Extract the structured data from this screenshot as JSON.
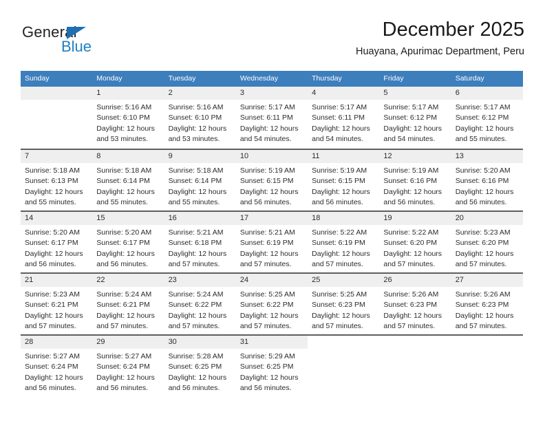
{
  "brand": {
    "name_top": "General",
    "name_bottom": "Blue",
    "triangle_color": "#1f6fb2",
    "blue_color": "#1f7fc4"
  },
  "header": {
    "title": "December 2025",
    "subtitle": "Huayana, Apurimac Department, Peru"
  },
  "theme": {
    "header_row_bg": "#3d7ebd",
    "header_row_text": "#ffffff",
    "daynum_bg": "#efefef",
    "week_divider": "#5b5f63",
    "body_text": "#2b2b2b"
  },
  "weekdays": [
    "Sunday",
    "Monday",
    "Tuesday",
    "Wednesday",
    "Thursday",
    "Friday",
    "Saturday"
  ],
  "labels": {
    "sunrise_prefix": "Sunrise:",
    "sunset_prefix": "Sunset:",
    "daylight_prefix": "Daylight:"
  },
  "weeks": [
    [
      {
        "day": "",
        "sunrise": "",
        "sunset": "",
        "daylight": "",
        "empty": true
      },
      {
        "day": "1",
        "sunrise": "Sunrise: 5:16 AM",
        "sunset": "Sunset: 6:10 PM",
        "daylight": "Daylight: 12 hours and 53 minutes."
      },
      {
        "day": "2",
        "sunrise": "Sunrise: 5:16 AM",
        "sunset": "Sunset: 6:10 PM",
        "daylight": "Daylight: 12 hours and 53 minutes."
      },
      {
        "day": "3",
        "sunrise": "Sunrise: 5:17 AM",
        "sunset": "Sunset: 6:11 PM",
        "daylight": "Daylight: 12 hours and 54 minutes."
      },
      {
        "day": "4",
        "sunrise": "Sunrise: 5:17 AM",
        "sunset": "Sunset: 6:11 PM",
        "daylight": "Daylight: 12 hours and 54 minutes."
      },
      {
        "day": "5",
        "sunrise": "Sunrise: 5:17 AM",
        "sunset": "Sunset: 6:12 PM",
        "daylight": "Daylight: 12 hours and 54 minutes."
      },
      {
        "day": "6",
        "sunrise": "Sunrise: 5:17 AM",
        "sunset": "Sunset: 6:12 PM",
        "daylight": "Daylight: 12 hours and 55 minutes."
      }
    ],
    [
      {
        "day": "7",
        "sunrise": "Sunrise: 5:18 AM",
        "sunset": "Sunset: 6:13 PM",
        "daylight": "Daylight: 12 hours and 55 minutes."
      },
      {
        "day": "8",
        "sunrise": "Sunrise: 5:18 AM",
        "sunset": "Sunset: 6:14 PM",
        "daylight": "Daylight: 12 hours and 55 minutes."
      },
      {
        "day": "9",
        "sunrise": "Sunrise: 5:18 AM",
        "sunset": "Sunset: 6:14 PM",
        "daylight": "Daylight: 12 hours and 55 minutes."
      },
      {
        "day": "10",
        "sunrise": "Sunrise: 5:19 AM",
        "sunset": "Sunset: 6:15 PM",
        "daylight": "Daylight: 12 hours and 56 minutes."
      },
      {
        "day": "11",
        "sunrise": "Sunrise: 5:19 AM",
        "sunset": "Sunset: 6:15 PM",
        "daylight": "Daylight: 12 hours and 56 minutes."
      },
      {
        "day": "12",
        "sunrise": "Sunrise: 5:19 AM",
        "sunset": "Sunset: 6:16 PM",
        "daylight": "Daylight: 12 hours and 56 minutes."
      },
      {
        "day": "13",
        "sunrise": "Sunrise: 5:20 AM",
        "sunset": "Sunset: 6:16 PM",
        "daylight": "Daylight: 12 hours and 56 minutes."
      }
    ],
    [
      {
        "day": "14",
        "sunrise": "Sunrise: 5:20 AM",
        "sunset": "Sunset: 6:17 PM",
        "daylight": "Daylight: 12 hours and 56 minutes."
      },
      {
        "day": "15",
        "sunrise": "Sunrise: 5:20 AM",
        "sunset": "Sunset: 6:17 PM",
        "daylight": "Daylight: 12 hours and 56 minutes."
      },
      {
        "day": "16",
        "sunrise": "Sunrise: 5:21 AM",
        "sunset": "Sunset: 6:18 PM",
        "daylight": "Daylight: 12 hours and 57 minutes."
      },
      {
        "day": "17",
        "sunrise": "Sunrise: 5:21 AM",
        "sunset": "Sunset: 6:19 PM",
        "daylight": "Daylight: 12 hours and 57 minutes."
      },
      {
        "day": "18",
        "sunrise": "Sunrise: 5:22 AM",
        "sunset": "Sunset: 6:19 PM",
        "daylight": "Daylight: 12 hours and 57 minutes."
      },
      {
        "day": "19",
        "sunrise": "Sunrise: 5:22 AM",
        "sunset": "Sunset: 6:20 PM",
        "daylight": "Daylight: 12 hours and 57 minutes."
      },
      {
        "day": "20",
        "sunrise": "Sunrise: 5:23 AM",
        "sunset": "Sunset: 6:20 PM",
        "daylight": "Daylight: 12 hours and 57 minutes."
      }
    ],
    [
      {
        "day": "21",
        "sunrise": "Sunrise: 5:23 AM",
        "sunset": "Sunset: 6:21 PM",
        "daylight": "Daylight: 12 hours and 57 minutes."
      },
      {
        "day": "22",
        "sunrise": "Sunrise: 5:24 AM",
        "sunset": "Sunset: 6:21 PM",
        "daylight": "Daylight: 12 hours and 57 minutes."
      },
      {
        "day": "23",
        "sunrise": "Sunrise: 5:24 AM",
        "sunset": "Sunset: 6:22 PM",
        "daylight": "Daylight: 12 hours and 57 minutes."
      },
      {
        "day": "24",
        "sunrise": "Sunrise: 5:25 AM",
        "sunset": "Sunset: 6:22 PM",
        "daylight": "Daylight: 12 hours and 57 minutes."
      },
      {
        "day": "25",
        "sunrise": "Sunrise: 5:25 AM",
        "sunset": "Sunset: 6:23 PM",
        "daylight": "Daylight: 12 hours and 57 minutes."
      },
      {
        "day": "26",
        "sunrise": "Sunrise: 5:26 AM",
        "sunset": "Sunset: 6:23 PM",
        "daylight": "Daylight: 12 hours and 57 minutes."
      },
      {
        "day": "27",
        "sunrise": "Sunrise: 5:26 AM",
        "sunset": "Sunset: 6:23 PM",
        "daylight": "Daylight: 12 hours and 57 minutes."
      }
    ],
    [
      {
        "day": "28",
        "sunrise": "Sunrise: 5:27 AM",
        "sunset": "Sunset: 6:24 PM",
        "daylight": "Daylight: 12 hours and 56 minutes."
      },
      {
        "day": "29",
        "sunrise": "Sunrise: 5:27 AM",
        "sunset": "Sunset: 6:24 PM",
        "daylight": "Daylight: 12 hours and 56 minutes."
      },
      {
        "day": "30",
        "sunrise": "Sunrise: 5:28 AM",
        "sunset": "Sunset: 6:25 PM",
        "daylight": "Daylight: 12 hours and 56 minutes."
      },
      {
        "day": "31",
        "sunrise": "Sunrise: 5:29 AM",
        "sunset": "Sunset: 6:25 PM",
        "daylight": "Daylight: 12 hours and 56 minutes."
      },
      {
        "day": "",
        "sunrise": "",
        "sunset": "",
        "daylight": "",
        "blank": true
      },
      {
        "day": "",
        "sunrise": "",
        "sunset": "",
        "daylight": "",
        "blank": true
      },
      {
        "day": "",
        "sunrise": "",
        "sunset": "",
        "daylight": "",
        "blank": true
      }
    ]
  ]
}
